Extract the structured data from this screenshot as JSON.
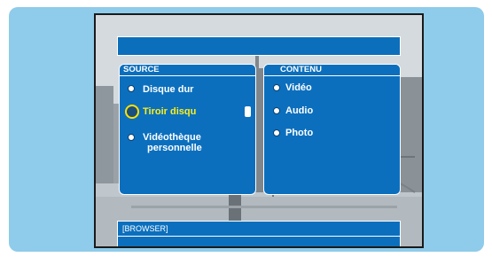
{
  "source_panel": {
    "header": "SOURCE",
    "items": [
      {
        "label": "Disque dur",
        "selected": false
      },
      {
        "label": "Tiroir disqu",
        "selected": true
      },
      {
        "label_line1": "Vidéothèque",
        "label_line2": "personnelle",
        "selected": false
      }
    ]
  },
  "content_panel": {
    "header": "CONTENU",
    "items": [
      {
        "label": "Vidéo"
      },
      {
        "label": "Audio"
      },
      {
        "label": "Photo"
      }
    ]
  },
  "status_bar": {
    "label": "[BROWSER]"
  },
  "colors": {
    "frame_bg": "#8fcbea",
    "panel_bg": "#0b6fbe",
    "selected_text": "#ffee1a",
    "text": "#ffffff"
  }
}
